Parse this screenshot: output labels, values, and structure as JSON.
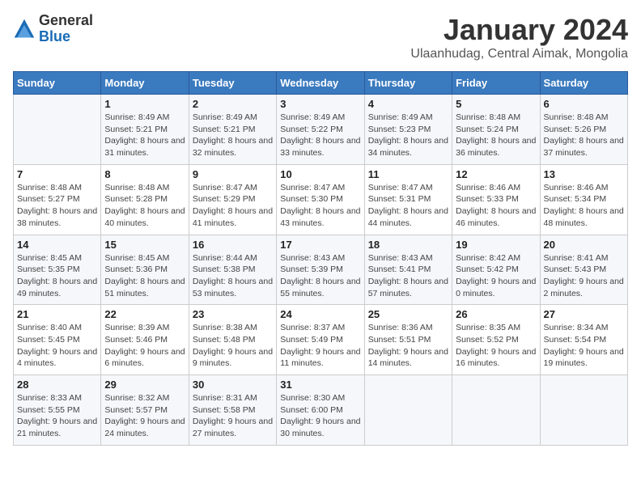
{
  "logo": {
    "general": "General",
    "blue": "Blue"
  },
  "header": {
    "title": "January 2024",
    "subtitle": "Ulaanhudag, Central Aimak, Mongolia"
  },
  "weekdays": [
    "Sunday",
    "Monday",
    "Tuesday",
    "Wednesday",
    "Thursday",
    "Friday",
    "Saturday"
  ],
  "weeks": [
    [
      {
        "day": "",
        "sunrise": "",
        "sunset": "",
        "daylight": ""
      },
      {
        "day": "1",
        "sunrise": "Sunrise: 8:49 AM",
        "sunset": "Sunset: 5:21 PM",
        "daylight": "Daylight: 8 hours and 31 minutes."
      },
      {
        "day": "2",
        "sunrise": "Sunrise: 8:49 AM",
        "sunset": "Sunset: 5:21 PM",
        "daylight": "Daylight: 8 hours and 32 minutes."
      },
      {
        "day": "3",
        "sunrise": "Sunrise: 8:49 AM",
        "sunset": "Sunset: 5:22 PM",
        "daylight": "Daylight: 8 hours and 33 minutes."
      },
      {
        "day": "4",
        "sunrise": "Sunrise: 8:49 AM",
        "sunset": "Sunset: 5:23 PM",
        "daylight": "Daylight: 8 hours and 34 minutes."
      },
      {
        "day": "5",
        "sunrise": "Sunrise: 8:48 AM",
        "sunset": "Sunset: 5:24 PM",
        "daylight": "Daylight: 8 hours and 36 minutes."
      },
      {
        "day": "6",
        "sunrise": "Sunrise: 8:48 AM",
        "sunset": "Sunset: 5:26 PM",
        "daylight": "Daylight: 8 hours and 37 minutes."
      }
    ],
    [
      {
        "day": "7",
        "sunrise": "Sunrise: 8:48 AM",
        "sunset": "Sunset: 5:27 PM",
        "daylight": "Daylight: 8 hours and 38 minutes."
      },
      {
        "day": "8",
        "sunrise": "Sunrise: 8:48 AM",
        "sunset": "Sunset: 5:28 PM",
        "daylight": "Daylight: 8 hours and 40 minutes."
      },
      {
        "day": "9",
        "sunrise": "Sunrise: 8:47 AM",
        "sunset": "Sunset: 5:29 PM",
        "daylight": "Daylight: 8 hours and 41 minutes."
      },
      {
        "day": "10",
        "sunrise": "Sunrise: 8:47 AM",
        "sunset": "Sunset: 5:30 PM",
        "daylight": "Daylight: 8 hours and 43 minutes."
      },
      {
        "day": "11",
        "sunrise": "Sunrise: 8:47 AM",
        "sunset": "Sunset: 5:31 PM",
        "daylight": "Daylight: 8 hours and 44 minutes."
      },
      {
        "day": "12",
        "sunrise": "Sunrise: 8:46 AM",
        "sunset": "Sunset: 5:33 PM",
        "daylight": "Daylight: 8 hours and 46 minutes."
      },
      {
        "day": "13",
        "sunrise": "Sunrise: 8:46 AM",
        "sunset": "Sunset: 5:34 PM",
        "daylight": "Daylight: 8 hours and 48 minutes."
      }
    ],
    [
      {
        "day": "14",
        "sunrise": "Sunrise: 8:45 AM",
        "sunset": "Sunset: 5:35 PM",
        "daylight": "Daylight: 8 hours and 49 minutes."
      },
      {
        "day": "15",
        "sunrise": "Sunrise: 8:45 AM",
        "sunset": "Sunset: 5:36 PM",
        "daylight": "Daylight: 8 hours and 51 minutes."
      },
      {
        "day": "16",
        "sunrise": "Sunrise: 8:44 AM",
        "sunset": "Sunset: 5:38 PM",
        "daylight": "Daylight: 8 hours and 53 minutes."
      },
      {
        "day": "17",
        "sunrise": "Sunrise: 8:43 AM",
        "sunset": "Sunset: 5:39 PM",
        "daylight": "Daylight: 8 hours and 55 minutes."
      },
      {
        "day": "18",
        "sunrise": "Sunrise: 8:43 AM",
        "sunset": "Sunset: 5:41 PM",
        "daylight": "Daylight: 8 hours and 57 minutes."
      },
      {
        "day": "19",
        "sunrise": "Sunrise: 8:42 AM",
        "sunset": "Sunset: 5:42 PM",
        "daylight": "Daylight: 9 hours and 0 minutes."
      },
      {
        "day": "20",
        "sunrise": "Sunrise: 8:41 AM",
        "sunset": "Sunset: 5:43 PM",
        "daylight": "Daylight: 9 hours and 2 minutes."
      }
    ],
    [
      {
        "day": "21",
        "sunrise": "Sunrise: 8:40 AM",
        "sunset": "Sunset: 5:45 PM",
        "daylight": "Daylight: 9 hours and 4 minutes."
      },
      {
        "day": "22",
        "sunrise": "Sunrise: 8:39 AM",
        "sunset": "Sunset: 5:46 PM",
        "daylight": "Daylight: 9 hours and 6 minutes."
      },
      {
        "day": "23",
        "sunrise": "Sunrise: 8:38 AM",
        "sunset": "Sunset: 5:48 PM",
        "daylight": "Daylight: 9 hours and 9 minutes."
      },
      {
        "day": "24",
        "sunrise": "Sunrise: 8:37 AM",
        "sunset": "Sunset: 5:49 PM",
        "daylight": "Daylight: 9 hours and 11 minutes."
      },
      {
        "day": "25",
        "sunrise": "Sunrise: 8:36 AM",
        "sunset": "Sunset: 5:51 PM",
        "daylight": "Daylight: 9 hours and 14 minutes."
      },
      {
        "day": "26",
        "sunrise": "Sunrise: 8:35 AM",
        "sunset": "Sunset: 5:52 PM",
        "daylight": "Daylight: 9 hours and 16 minutes."
      },
      {
        "day": "27",
        "sunrise": "Sunrise: 8:34 AM",
        "sunset": "Sunset: 5:54 PM",
        "daylight": "Daylight: 9 hours and 19 minutes."
      }
    ],
    [
      {
        "day": "28",
        "sunrise": "Sunrise: 8:33 AM",
        "sunset": "Sunset: 5:55 PM",
        "daylight": "Daylight: 9 hours and 21 minutes."
      },
      {
        "day": "29",
        "sunrise": "Sunrise: 8:32 AM",
        "sunset": "Sunset: 5:57 PM",
        "daylight": "Daylight: 9 hours and 24 minutes."
      },
      {
        "day": "30",
        "sunrise": "Sunrise: 8:31 AM",
        "sunset": "Sunset: 5:58 PM",
        "daylight": "Daylight: 9 hours and 27 minutes."
      },
      {
        "day": "31",
        "sunrise": "Sunrise: 8:30 AM",
        "sunset": "Sunset: 6:00 PM",
        "daylight": "Daylight: 9 hours and 30 minutes."
      },
      {
        "day": "",
        "sunrise": "",
        "sunset": "",
        "daylight": ""
      },
      {
        "day": "",
        "sunrise": "",
        "sunset": "",
        "daylight": ""
      },
      {
        "day": "",
        "sunrise": "",
        "sunset": "",
        "daylight": ""
      }
    ]
  ]
}
